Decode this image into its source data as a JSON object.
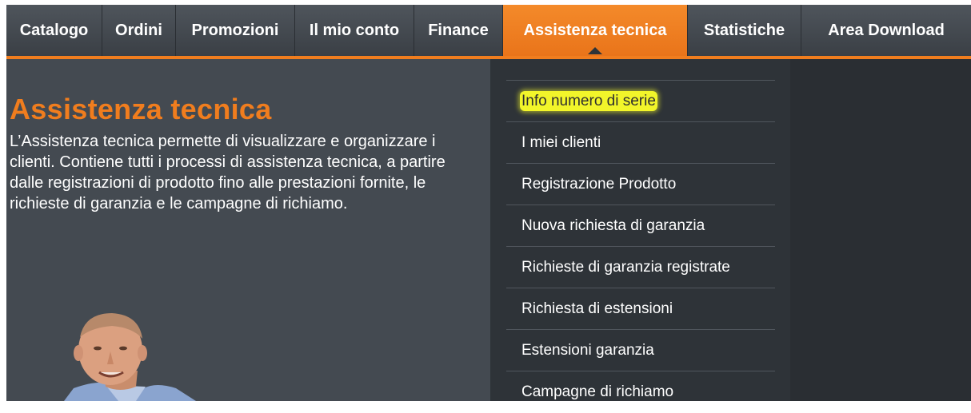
{
  "topnav": {
    "items": [
      {
        "label": "Catalogo"
      },
      {
        "label": "Ordini"
      },
      {
        "label": "Promozioni"
      },
      {
        "label": "Il mio conto"
      },
      {
        "label": "Finance"
      },
      {
        "label": "Assistenza tecnica",
        "active": true
      },
      {
        "label": "Statistiche"
      },
      {
        "label": "Area Download"
      }
    ]
  },
  "main": {
    "title": "Assistenza tecnica",
    "description": "L’Assistenza tecnica permette di visualizzare e organizzare i clienti. Contiene tutti i processi di assistenza tecnica, a partire dalle registrazioni di prodotto fino alle prestazioni fornite, le richieste di garanzia e le campagne di richiamo."
  },
  "submenu": {
    "items": [
      {
        "label": "Info numero di serie",
        "highlighted": true
      },
      {
        "label": "I miei clienti"
      },
      {
        "label": "Registrazione Prodotto"
      },
      {
        "label": "Nuova richiesta di garanzia"
      },
      {
        "label": "Richieste di garanzia registrate"
      },
      {
        "label": "Richiesta di estensioni"
      },
      {
        "label": "Estensioni garanzia"
      },
      {
        "label": "Campagne di richiamo"
      }
    ]
  },
  "colors": {
    "accent": "#f07d1e",
    "nav_bg": "#44494f",
    "highlight": "#f2f52a"
  }
}
